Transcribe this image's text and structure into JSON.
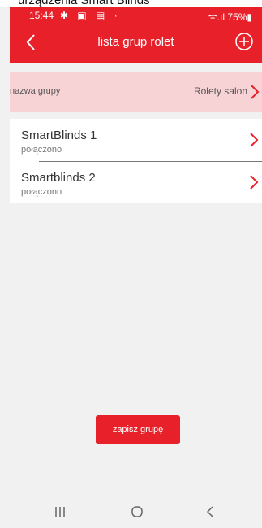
{
  "caption": "urządzenia Smart Blinds",
  "status": {
    "time": "15:44",
    "icons": "✱ ▣ ▤ ·",
    "right": "ᯤ.ıl 75%▮"
  },
  "header": {
    "title": "lista grup rolet"
  },
  "group": {
    "label": "nazwa grupy",
    "value": "Rolety salon"
  },
  "devices": [
    {
      "name": "SmartBlinds 1",
      "status": "połączono"
    },
    {
      "name": "Smartblinds 2",
      "status": "połączono"
    }
  ],
  "save_label": "zapisz grupę",
  "colors": {
    "accent": "#e8202a",
    "highlight": "#f8d3d5",
    "background": "#f1f1f1"
  },
  "icons": [
    "back-arrow-icon",
    "add-circle-icon",
    "chevron-right-icon",
    "recent-apps-icon",
    "home-icon",
    "nav-back-icon"
  ]
}
